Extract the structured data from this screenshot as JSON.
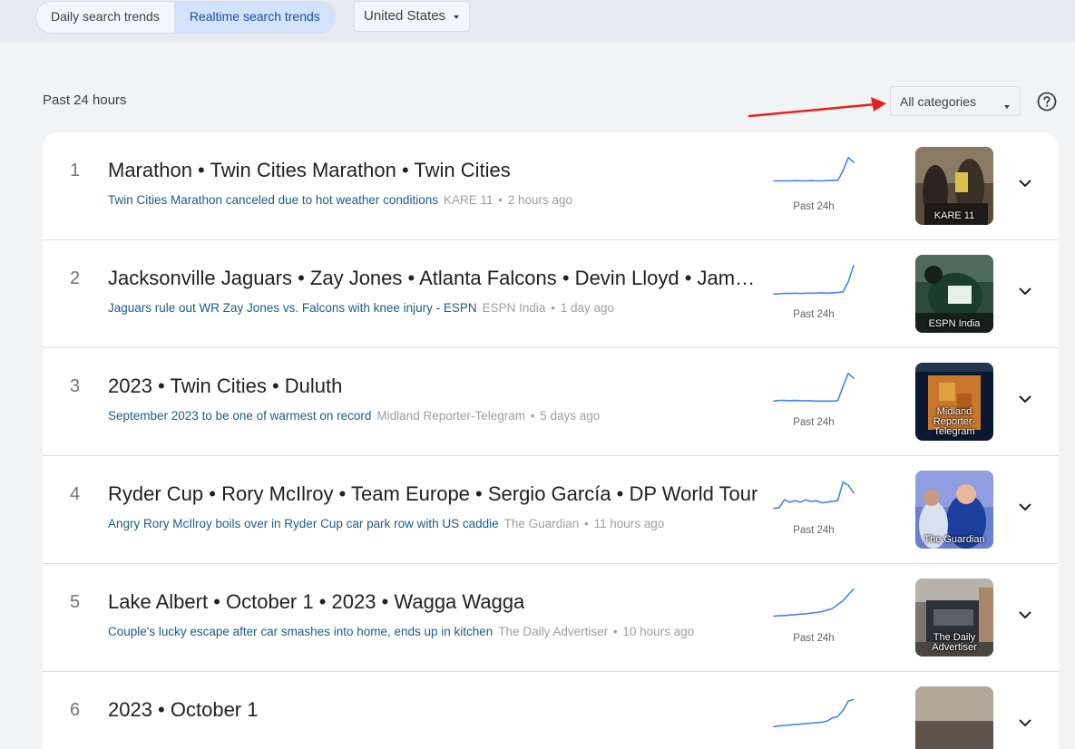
{
  "header": {
    "tabs": [
      {
        "label": "Daily search trends",
        "active": false
      },
      {
        "label": "Realtime search trends",
        "active": true
      }
    ],
    "country": "United States"
  },
  "filters": {
    "period": "Past 24 hours",
    "category": "All categories",
    "help_icon": "help-circle-icon"
  },
  "colors": {
    "accent": "#d3e3fd",
    "link": "#1a5b8c",
    "sparkline": "#4285f4",
    "annotation_arrow": "#e8201b"
  },
  "trends": [
    {
      "rank": "1",
      "title": "Marathon • Twin Cities Marathon • Twin Cities",
      "article": "Twin Cities Marathon canceled due to hot weather conditions",
      "source": "KARE 11",
      "time_ago": "2 hours ago",
      "spark_label": "Past 24h",
      "thumb_label": "KARE 11",
      "sparkline": [
        0.22,
        0.22,
        0.22,
        0.22,
        0.23,
        0.22,
        0.22,
        0.23,
        0.22,
        0.22,
        0.23,
        0.24,
        0.23,
        0.55,
        0.98,
        0.82
      ]
    },
    {
      "rank": "2",
      "title": "Jacksonville Jaguars • Zay Jones • Atlanta Falcons • Devin Lloyd • Jamal Agnew",
      "article": "Jaguars rule out WR Zay Jones vs. Falcons with knee injury - ESPN",
      "source": "ESPN India",
      "time_ago": "1 day ago",
      "spark_label": "Past 24h",
      "thumb_label": "ESPN India",
      "sparkline": [
        0.05,
        0.06,
        0.07,
        0.07,
        0.08,
        0.07,
        0.08,
        0.08,
        0.08,
        0.09,
        0.08,
        0.09,
        0.1,
        0.12,
        0.45,
        0.98
      ]
    },
    {
      "rank": "3",
      "title": "2023 • Twin Cities • Duluth",
      "article": "September 2023 to be one of warmest on record",
      "source": "Midland Reporter-Telegram",
      "time_ago": "5 days ago",
      "spark_label": "Past 24h",
      "thumb_label": "Midland Reporter-Telegram",
      "sparkline": [
        0.08,
        0.1,
        0.1,
        0.09,
        0.1,
        0.09,
        0.09,
        0.09,
        0.08,
        0.08,
        0.08,
        0.08,
        0.09,
        0.55,
        0.98,
        0.82
      ]
    },
    {
      "rank": "4",
      "title": "Ryder Cup • Rory McIlroy • Team Europe • Sergio García • DP World Tour",
      "article": "Angry Rory McIlroy boils over in Ryder Cup car park row with US caddie",
      "source": "The Guardian",
      "time_ago": "11 hours ago",
      "spark_label": "Past 24h",
      "thumb_label": "The Guardian",
      "sparkline": [
        0.1,
        0.12,
        0.38,
        0.3,
        0.35,
        0.3,
        0.38,
        0.32,
        0.35,
        0.28,
        0.3,
        0.33,
        0.35,
        0.95,
        0.85,
        0.6
      ]
    },
    {
      "rank": "5",
      "title": "Lake Albert • October 1 • 2023 • Wagga Wagga",
      "article": "Couple's lucky escape after car smashes into home, ends up in kitchen",
      "source": "The Daily Advertiser",
      "time_ago": "10 hours ago",
      "spark_label": "Past 24h",
      "thumb_label": "The Daily Advertiser",
      "sparkline": [
        0.1,
        0.12,
        0.12,
        0.14,
        0.15,
        0.17,
        0.18,
        0.2,
        0.22,
        0.25,
        0.3,
        0.35,
        0.48,
        0.6,
        0.8,
        0.98
      ]
    },
    {
      "rank": "6",
      "title": "2023 • October 1",
      "article": "",
      "source": "",
      "time_ago": "",
      "spark_label": "",
      "thumb_label": "",
      "sparkline": [
        0.02,
        0.04,
        0.06,
        0.07,
        0.09,
        0.1,
        0.12,
        0.13,
        0.15,
        0.16,
        0.2,
        0.3,
        0.35,
        0.55,
        0.85,
        0.9
      ]
    }
  ]
}
